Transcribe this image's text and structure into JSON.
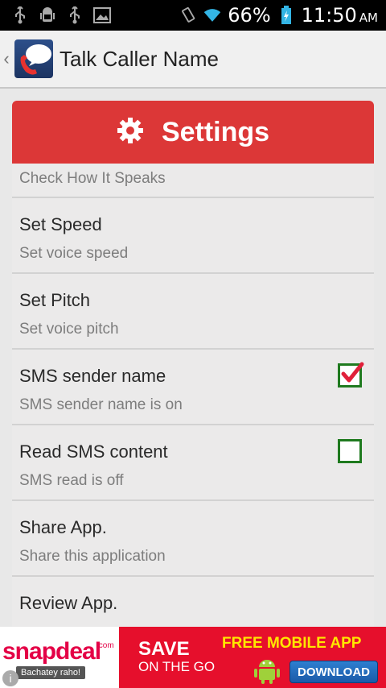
{
  "status_bar": {
    "icons_left": [
      "usb-icon",
      "android-debug-icon",
      "usb-icon",
      "image-icon"
    ],
    "battery_percent": "66%",
    "time": "11:50",
    "ampm": "AM"
  },
  "action_bar": {
    "title": "Talk Caller Name"
  },
  "settings": {
    "header": "Settings",
    "items": [
      {
        "title": "",
        "summary": "Check How It Speaks"
      },
      {
        "title": "Set Speed",
        "summary": "Set voice speed"
      },
      {
        "title": "Set Pitch",
        "summary": "Set voice pitch"
      },
      {
        "title": "SMS sender name",
        "summary": "SMS sender name is on",
        "checked": true
      },
      {
        "title": "Read SMS content",
        "summary": "SMS read is off",
        "checked": false
      },
      {
        "title": "Share App.",
        "summary": "Share this application"
      },
      {
        "title": "Review App.",
        "summary": ""
      }
    ]
  },
  "ad": {
    "brand": "snapdeal",
    "brand_suffix": ".com",
    "tagline": "Bachatey raho!",
    "save": "SAVE",
    "on_the_go": "ON THE GO",
    "free_app": "FREE MOBILE APP",
    "download": "DOWNLOAD"
  },
  "colors": {
    "header_red": "#dc3737",
    "checkbox_green": "#1f7a1f",
    "check_red": "#e0203a",
    "ad_red": "#e60f2c"
  }
}
